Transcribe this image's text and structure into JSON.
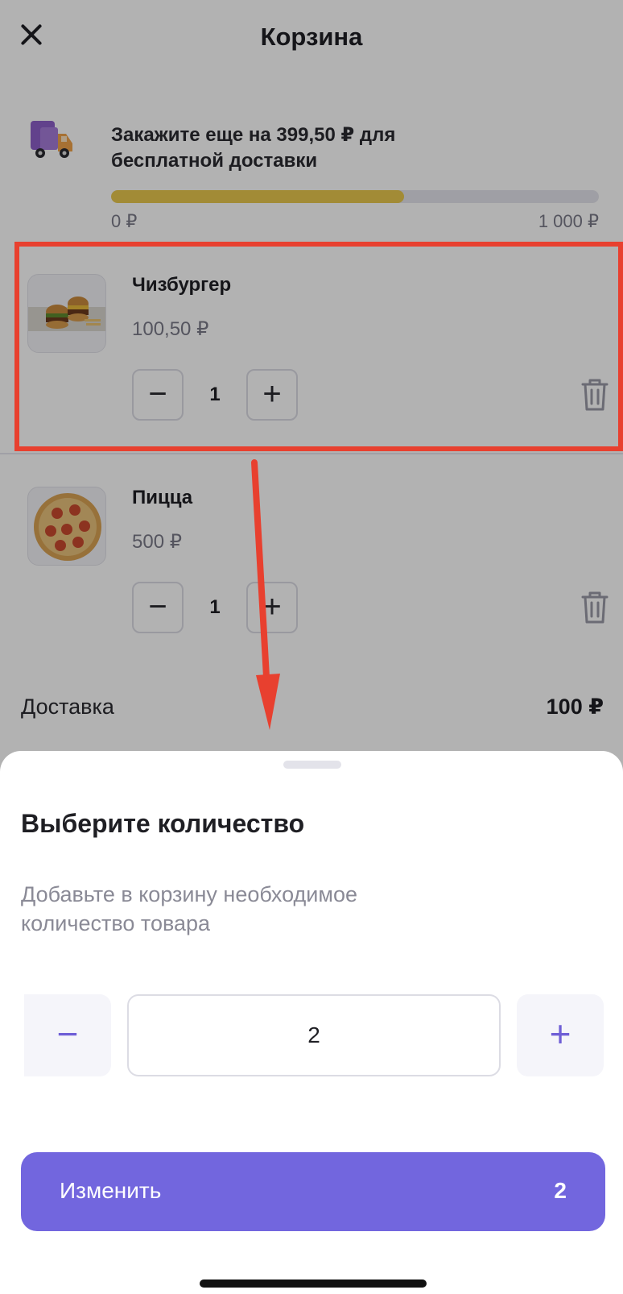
{
  "header": {
    "title": "Корзина",
    "close_icon": "close-icon"
  },
  "promo": {
    "text": "Закажите еще на 399,50 ₽ для бесплатной доставки",
    "progress_fraction": 0.6,
    "range_min": "0 ₽",
    "range_max": "1 000 ₽",
    "bar_color": "#e8c84e"
  },
  "cart": {
    "items": [
      {
        "name": "Чизбургер",
        "price": "100,50 ₽",
        "quantity": "1",
        "minus": "−",
        "plus": "+"
      },
      {
        "name": "Пицца",
        "price": "500 ₽",
        "quantity": "1",
        "minus": "−",
        "plus": "+"
      }
    ]
  },
  "delivery": {
    "label": "Доставка",
    "value": "100 ₽"
  },
  "sheet": {
    "title": "Выберите количество",
    "subtitle": "Добавьте в корзину необходимое количество товара",
    "minus": "−",
    "plus": "+",
    "quantity_value": "2",
    "submit_label": "Изменить",
    "submit_count": "2",
    "accent_color": "#7266de"
  },
  "annotation": {
    "highlight_color": "#e8402f"
  }
}
